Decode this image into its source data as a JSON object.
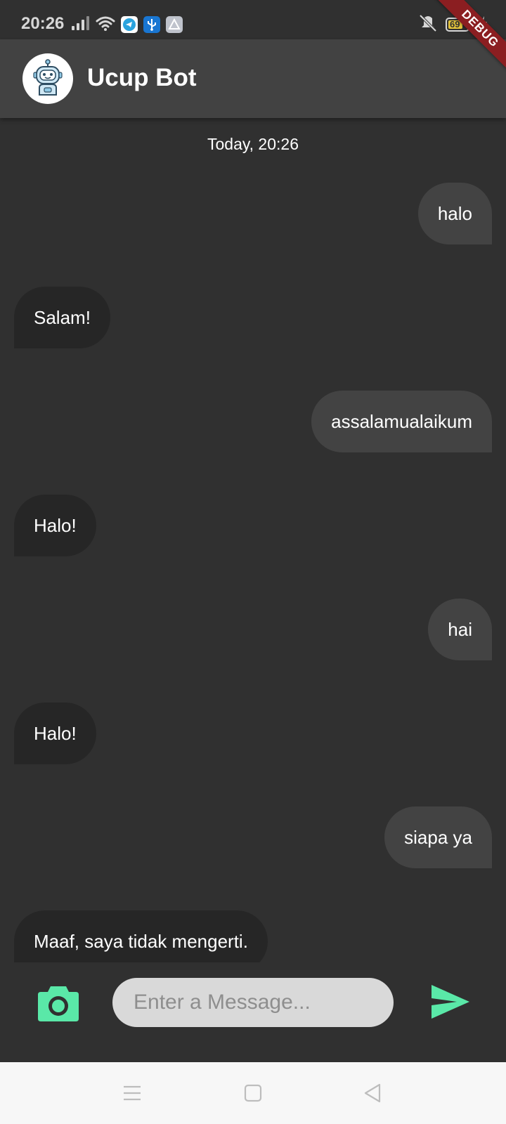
{
  "status_bar": {
    "time": "20:26",
    "icons": [
      "signal-icon",
      "wifi-icon",
      "telegram-icon",
      "usb-icon",
      "app-icon",
      "mute-icon",
      "battery-icon",
      "charging-icon"
    ],
    "battery_level": "69"
  },
  "debug_banner": "DEBUG",
  "header": {
    "title": "Ucup Bot",
    "avatar_icon": "robot-icon"
  },
  "chat": {
    "date_label": "Today, 20:26",
    "messages": [
      {
        "sender": "user",
        "text": "halo"
      },
      {
        "sender": "bot",
        "text": "Salam!"
      },
      {
        "sender": "user",
        "text": "assalamualaikum"
      },
      {
        "sender": "bot",
        "text": "Halo!"
      },
      {
        "sender": "user",
        "text": "hai"
      },
      {
        "sender": "bot",
        "text": "Halo!"
      },
      {
        "sender": "user",
        "text": "siapa ya"
      },
      {
        "sender": "bot",
        "text": "Maaf, saya tidak mengerti."
      }
    ]
  },
  "input_bar": {
    "placeholder": "Enter a Message...",
    "value": "",
    "camera_icon": "camera-icon",
    "send_icon": "send-icon"
  },
  "nav_bar": {
    "icons": [
      "menu-icon",
      "home-icon",
      "back-icon"
    ]
  },
  "colors": {
    "background": "#303030",
    "app_bar": "#424242",
    "user_bubble": "#434343",
    "bot_bubble": "#262626",
    "accent": "#5ae8a8",
    "debug_ribbon": "#8b1e21",
    "nav_bar": "#f7f7f7"
  }
}
